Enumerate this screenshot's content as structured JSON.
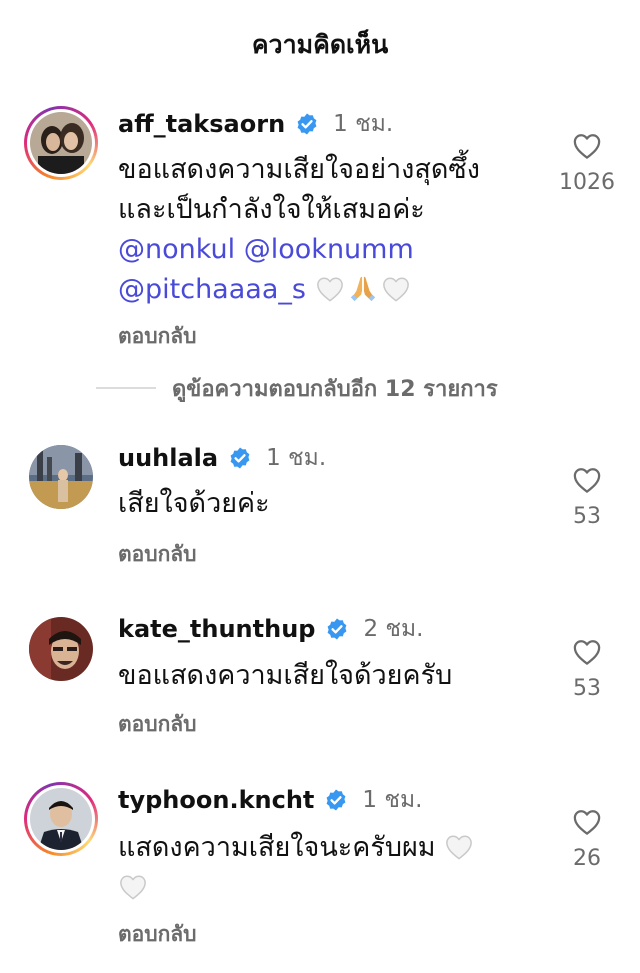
{
  "header": {
    "title": "ความคิดเห็น"
  },
  "reply_label": "ตอบกลับ",
  "more_replies": "ดูข้อความตอบกลับอีก 12 รายการ",
  "comments": [
    {
      "username": "aff_taksaorn",
      "verified": true,
      "time": "1 ชม.",
      "line1": "ขอแสดงความเสียใจอย่างสุดซึ้ง",
      "line2": "และเป็นกำลังใจให้เสมอค่ะ",
      "mentions": [
        "@nonkul",
        "@looknumm",
        "@pitchaaaa_s"
      ],
      "likes": "1026",
      "has_story_ring": true
    },
    {
      "username": "uuhlala",
      "verified": true,
      "time": "1 ชม.",
      "text": "เสียใจด้วยค่ะ",
      "likes": "53",
      "has_story_ring": false
    },
    {
      "username": "kate_thunthup",
      "verified": true,
      "time": "2 ชม.",
      "text": "ขอแสดงความเสียใจด้วยครับ",
      "likes": "53",
      "has_story_ring": false
    },
    {
      "username": "typhoon.kncht",
      "verified": true,
      "time": "1 ชม.",
      "text": "แสดงความเสียใจนะครับผม",
      "likes": "26",
      "has_story_ring": true
    }
  ],
  "icons": {
    "verified": "verified-badge-icon",
    "like": "heart-outline-icon",
    "white_heart": "white-heart-emoji",
    "pray": "folded-hands-emoji"
  },
  "colors": {
    "verified_blue": "#3897f0",
    "mention_blue": "#4a4ad8",
    "secondary_text": "#6b6b6b"
  }
}
